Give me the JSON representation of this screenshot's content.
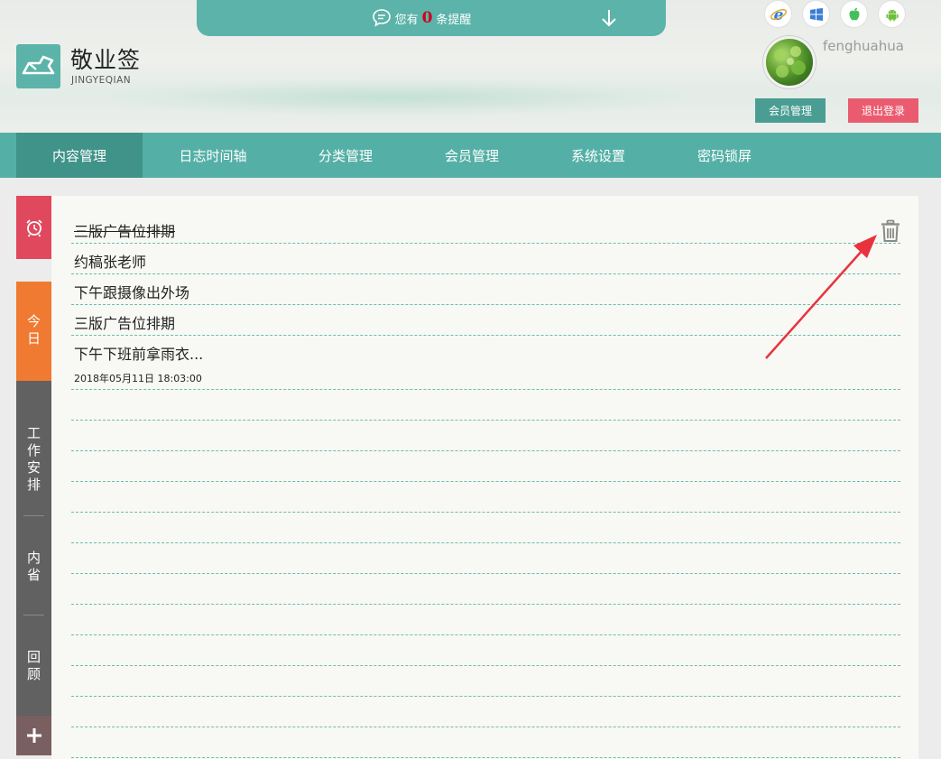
{
  "header": {
    "notice": {
      "prefix": "您有",
      "count": "0",
      "suffix": "条提醒"
    },
    "brand": {
      "title": "敬业签",
      "subtitle": "JINGYEQIAN"
    },
    "os_icons": [
      "ie-icon",
      "windows-icon",
      "apple-icon",
      "android-icon"
    ],
    "user": {
      "name": "fenghuahua"
    },
    "buttons": {
      "member": "会员管理",
      "logout": "退出登录"
    }
  },
  "nav": {
    "items": [
      {
        "label": "内容管理",
        "active": true
      },
      {
        "label": "日志时间轴",
        "active": false
      },
      {
        "label": "分类管理",
        "active": false
      },
      {
        "label": "会员管理",
        "active": false
      },
      {
        "label": "系统设置",
        "active": false
      },
      {
        "label": "密码锁屏",
        "active": false
      }
    ]
  },
  "sidebar": {
    "today": "今日",
    "tabs": [
      "工作安排",
      "内省",
      "回顾"
    ],
    "add": "+"
  },
  "notes": {
    "items": [
      {
        "text": "三版广告位排期",
        "done": true
      },
      {
        "text": "约稿张老师",
        "done": false
      },
      {
        "text": "下午跟摄像出外场",
        "done": false
      },
      {
        "text": "三版广告位排期",
        "done": false
      },
      {
        "text": "下午下班前拿雨衣...",
        "done": false
      }
    ],
    "date": "2018年05月11日 18:03:00"
  },
  "colors": {
    "teal": "#54b0a6",
    "teal_dark": "#3f9388",
    "red": "#e0485e",
    "orange": "#f07a31",
    "gray": "#616161",
    "count_red": "#d0021b",
    "arrow_red": "#e8333f"
  }
}
